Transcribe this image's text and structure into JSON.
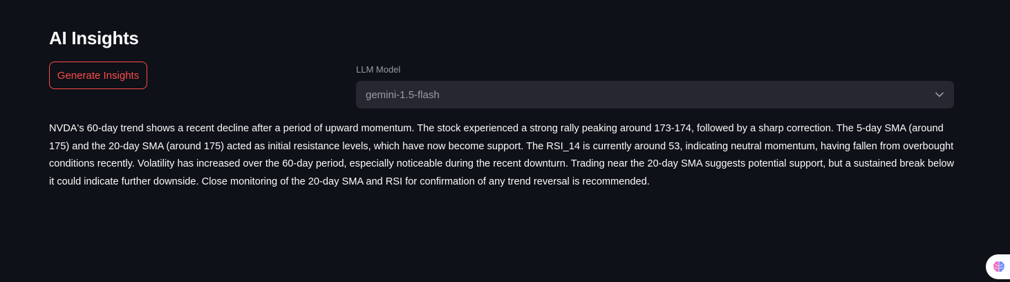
{
  "section": {
    "title": "AI Insights"
  },
  "generate_button": {
    "label": "Generate Insights"
  },
  "model_select": {
    "label": "LLM Model",
    "value": "gemini-1.5-flash",
    "icon": "chevron-down-icon"
  },
  "insights": {
    "text": "NVDA's 60-day trend shows a recent decline after a period of upward momentum. The stock experienced a strong rally peaking around 173-174, followed by a sharp correction. The 5-day SMA (around 175) and the 20-day SMA (around 175) acted as initial resistance levels, which have now become support. The RSI_14 is currently around 53, indicating neutral momentum, having fallen from overbought conditions recently. Volatility has increased over the 60-day period, especially noticeable during the recent downturn. Trading near the 20-day SMA suggests potential support, but a sustained break below it could indicate further downside. Close monitoring of the 20-day SMA and RSI for confirmation of any trend reversal is recommended."
  },
  "floating_badge": {
    "icon": "brain-icon"
  },
  "colors": {
    "background": "#0e1117",
    "accent": "#ff4b4b",
    "select_bg": "#262730",
    "muted_text": "#9a9ba5",
    "text": "#fafafa"
  }
}
